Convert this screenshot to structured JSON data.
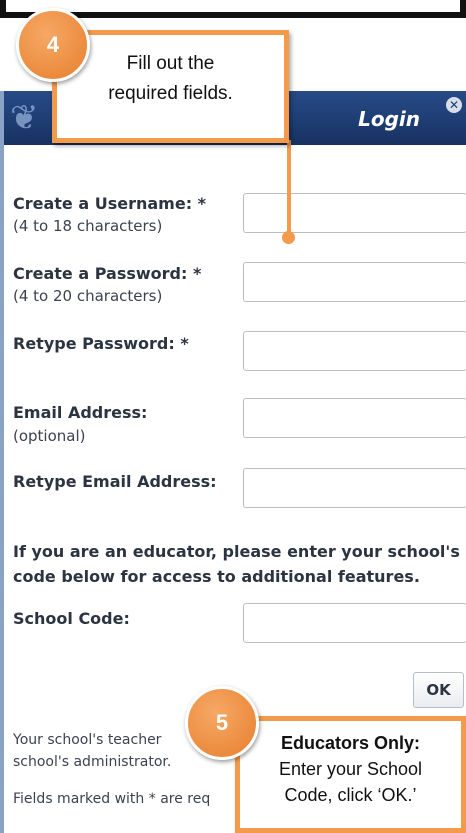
{
  "dialog": {
    "title": "Login",
    "close_glyph": "✕"
  },
  "form": {
    "username": {
      "label": "Create a Username: *",
      "hint": "(4 to 18 characters)",
      "value": ""
    },
    "password": {
      "label": "Create a Password: *",
      "hint": "(4 to 20 characters)",
      "value": ""
    },
    "retype_password": {
      "label": "Retype Password: *",
      "value": ""
    },
    "email": {
      "label": "Email Address:",
      "hint": "(optional)",
      "value": ""
    },
    "retype_email": {
      "label": "Retype Email Address:",
      "value": ""
    },
    "educator_prompt": "If you are an educator, please enter your school's code below for access to additional features.",
    "school_code": {
      "label": "School Code:",
      "value": ""
    },
    "ok_label": "OK"
  },
  "footer": {
    "line1": "Your school's teacher",
    "line2": "school's administrator.",
    "line3": "Fields marked with * are req"
  },
  "callouts": {
    "step4": {
      "number": "4",
      "text_line1": "Fill out the",
      "text_line2": "required fields."
    },
    "step5": {
      "number": "5",
      "title": "Educators Only:",
      "text_line1": "Enter your School",
      "text_line2": "Code, click ‘OK.’"
    }
  },
  "colors": {
    "accent_orange": "#f39a4b",
    "title_bar_blue": "#1d3c72"
  },
  "icons": {
    "close": "close-icon",
    "logo": "leaf-logo-icon"
  }
}
